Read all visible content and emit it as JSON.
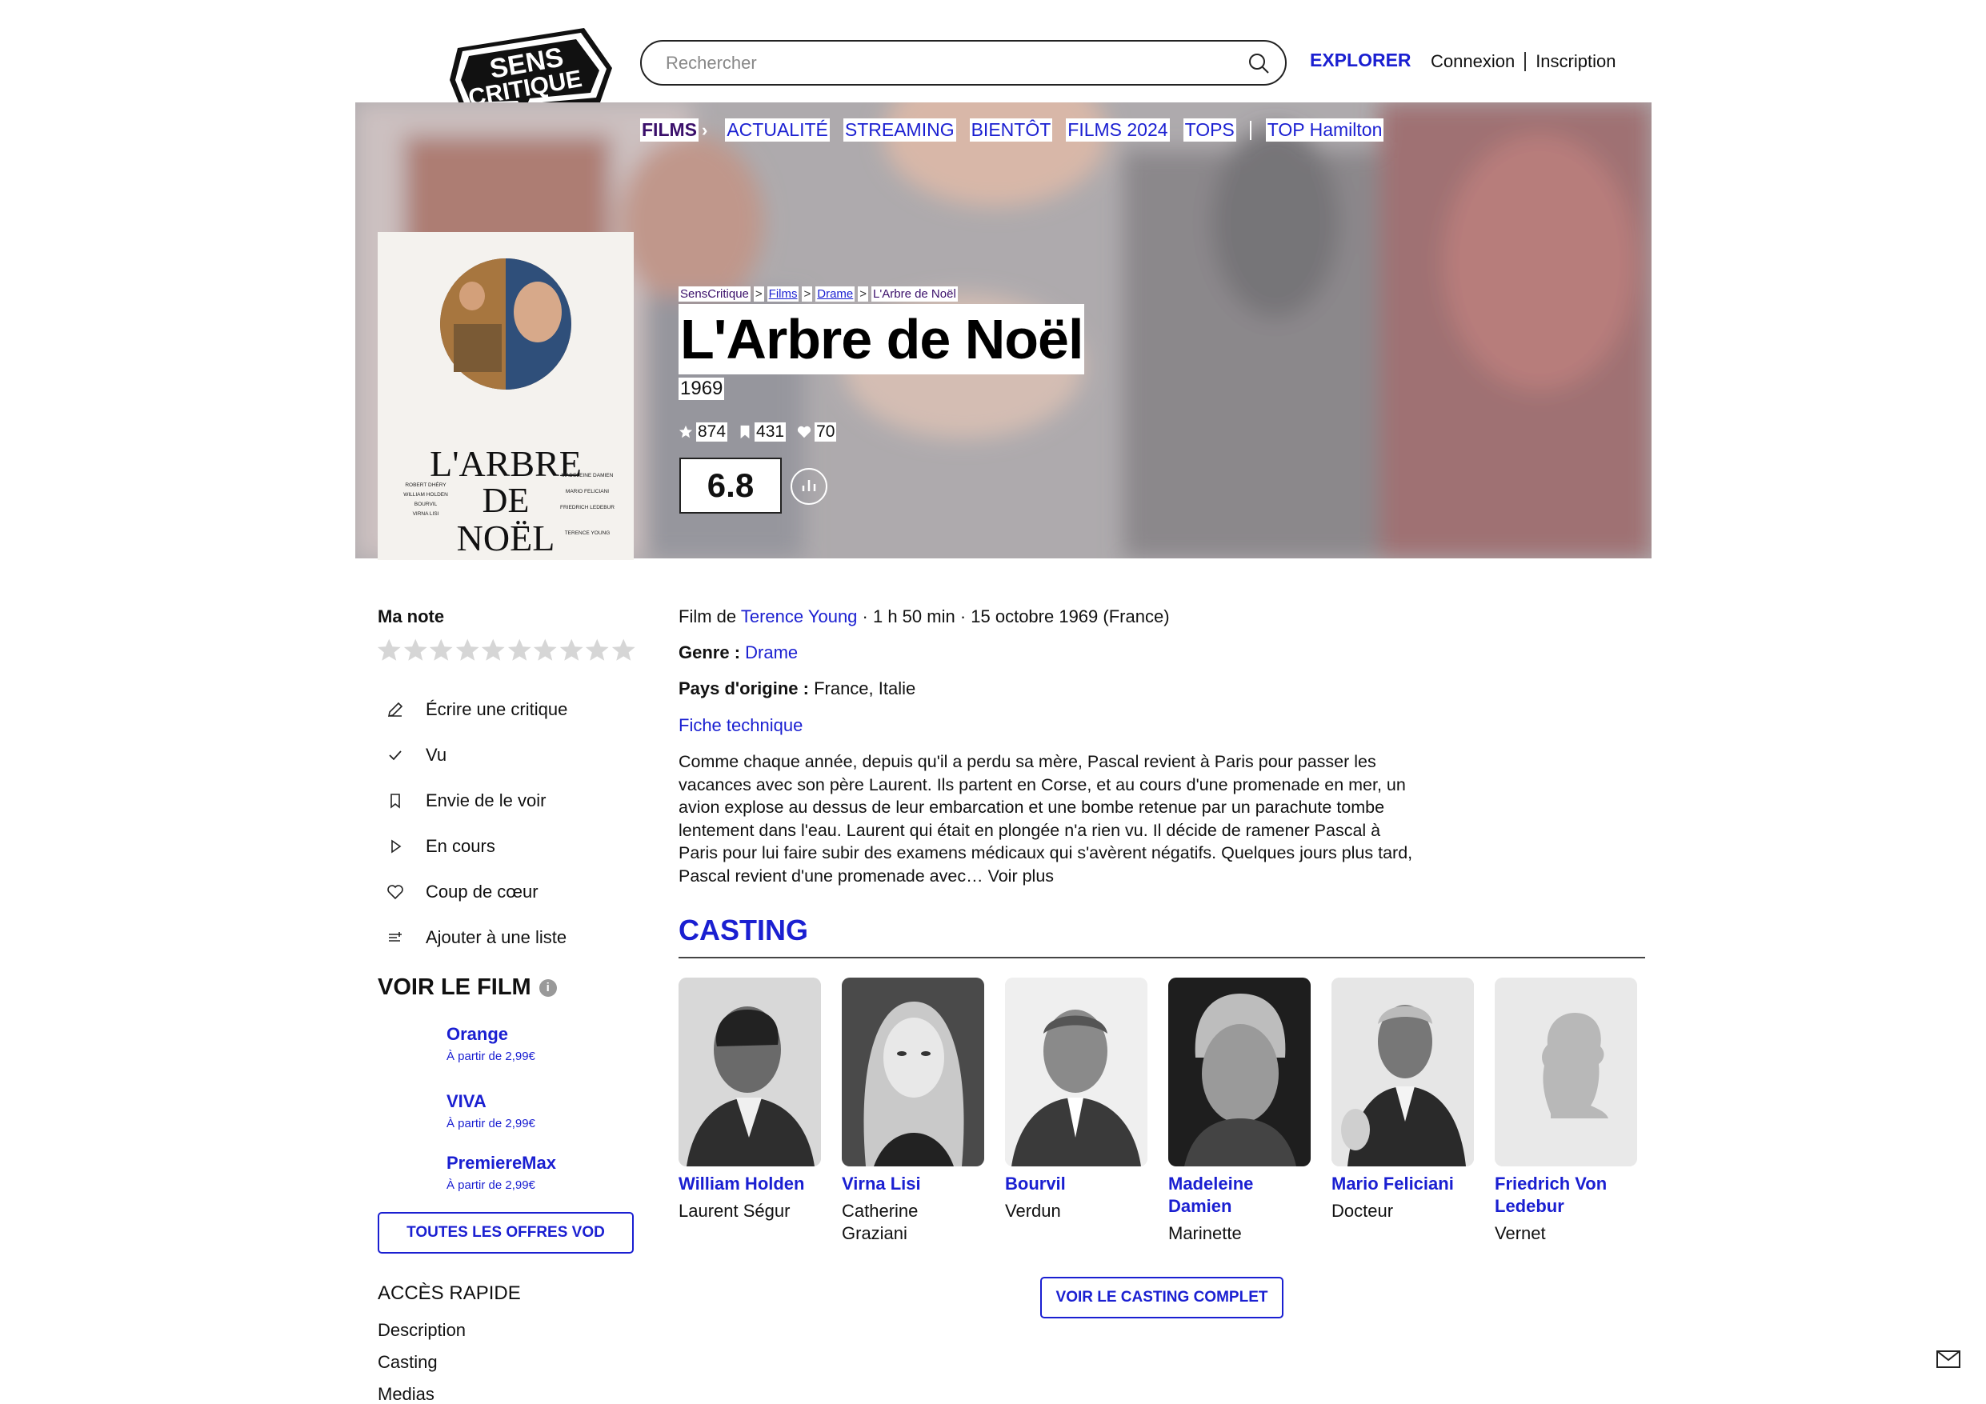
{
  "header": {
    "logo_text": [
      "SENS",
      "CRITIQUE"
    ],
    "search_placeholder": "Rechercher",
    "explorer": "EXPLORER",
    "login": "Connexion",
    "signup": "Inscription"
  },
  "subnav": {
    "films": "FILMS",
    "items": [
      "ACTUALITÉ",
      "STREAMING",
      "BIENTÔT",
      "FILMS 2024",
      "TOPS"
    ],
    "top_label": "TOP Hamilton"
  },
  "breadcrumb": [
    "SensCritique",
    "Films",
    "Drame",
    "L'Arbre de Noël"
  ],
  "poster": {
    "title_lines": [
      "L'ARBRE",
      "DE",
      "NOËL"
    ],
    "credits_left": [
      "ROBERT DHÉRY",
      "WILLIAM HOLDEN",
      "BOURVIL",
      "VIRNA LISI"
    ],
    "credits_right": [
      "MADELEINE DAMIEN",
      "MARIO FELICIANI",
      "FRIEDRICH LEDEBUR",
      "TERENCE YOUNG"
    ]
  },
  "film": {
    "title": "L'Arbre de Noël",
    "year": "1969",
    "ratings_count": "874",
    "wishlist_count": "431",
    "favorites_count": "70",
    "score": "6.8",
    "director_prefix": "Film de",
    "director": "Terence Young",
    "meta_rest": "· 1 h 50 min · 15 octobre 1969 (France)",
    "genre_label": "Genre :",
    "genre": "Drame",
    "country_label": "Pays d'origine :",
    "countries": "France, Italie",
    "fiche": "Fiche technique",
    "synopsis": "Comme chaque année, depuis qu'il a perdu sa mère, Pascal revient à Paris pour passer les vacances avec son père Laurent. Ils partent en Corse, et au cours d'une promenade en mer, un avion explose au dessus de leur embarcation et une bombe retenue par un parachute tombe lentement dans l'eau. Laurent qui était en plongée n'a rien vu. Il décide de ramener Pascal à Paris pour lui faire subir des examens médicaux qui s'avèrent négatifs. Quelques jours plus tard, Pascal revient d'une promenade avec…",
    "read_more": "Voir plus"
  },
  "sidebar": {
    "my_rating": "Ma note",
    "stars": 10,
    "actions": [
      {
        "icon": "pencil-icon",
        "label": "Écrire une critique"
      },
      {
        "icon": "check-icon",
        "label": "Vu"
      },
      {
        "icon": "bookmark-icon",
        "label": "Envie de le voir"
      },
      {
        "icon": "play-icon",
        "label": "En cours"
      },
      {
        "icon": "heart-icon",
        "label": "Coup de cœur"
      },
      {
        "icon": "add-list-icon",
        "label": "Ajouter à une liste"
      }
    ],
    "watch_title": "VOIR LE FILM",
    "vod": [
      {
        "name": "Orange",
        "price": "À partir de 2,99€"
      },
      {
        "name": "VIVA",
        "price": "À partir de 2,99€"
      },
      {
        "name": "PremiereMax",
        "price": "À partir de 2,99€"
      }
    ],
    "vod_all": "TOUTES LES OFFRES VOD",
    "quick_title": "ACCÈS RAPIDE",
    "quick_links": [
      "Description",
      "Casting",
      "Medias"
    ]
  },
  "casting": {
    "title": "CASTING",
    "members": [
      {
        "actor": "William Holden",
        "role": "Laurent Ségur"
      },
      {
        "actor": "Virna Lisi",
        "role": "Catherine Graziani"
      },
      {
        "actor": "Bourvil",
        "role": "Verdun"
      },
      {
        "actor": "Madeleine Damien",
        "role": "Marinette"
      },
      {
        "actor": "Mario Feliciani",
        "role": "Docteur"
      },
      {
        "actor": "Friedrich Von Ledebur",
        "role": "Vernet"
      }
    ],
    "all_button": "VOIR LE CASTING COMPLET"
  },
  "colors": {
    "brand_blue": "#1a1fd1",
    "films_purple": "#3a0f6a"
  }
}
